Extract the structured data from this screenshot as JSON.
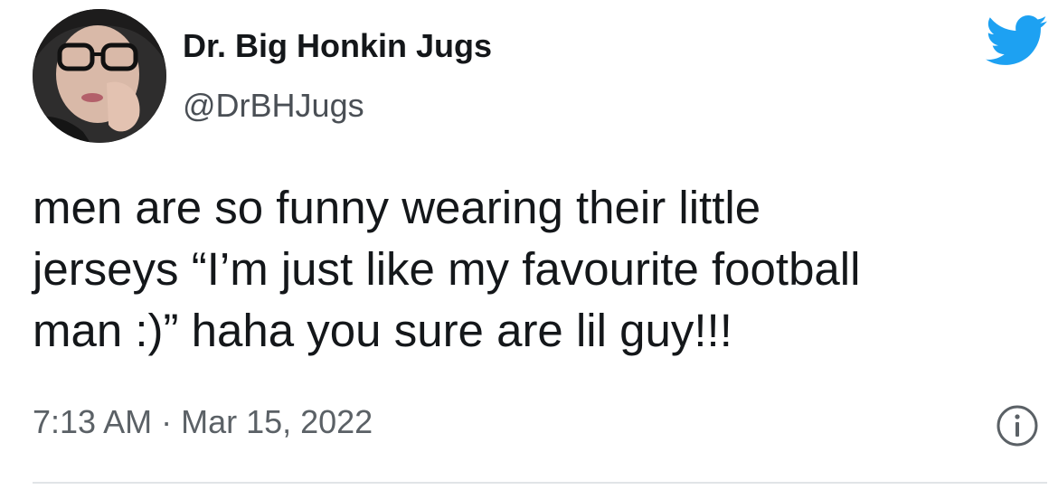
{
  "colors": {
    "twitter_blue": "#1da1f2",
    "text_primary": "#14171a",
    "text_secondary": "#5b6166",
    "divider": "#e1e4e7"
  },
  "author": {
    "display_name": "Dr. Big Honkin Jugs",
    "handle": "@DrBHJugs",
    "avatar_icon": "profile-photo"
  },
  "tweet": {
    "lines": [
      "men are so funny wearing their little",
      "jerseys “I’m just like my favourite football",
      "man :)” haha you sure are lil guy!!!"
    ],
    "timestamp": "7:13 AM · Mar 15, 2022"
  },
  "icons": {
    "brand": "twitter-bird-icon",
    "info": "info-icon"
  }
}
